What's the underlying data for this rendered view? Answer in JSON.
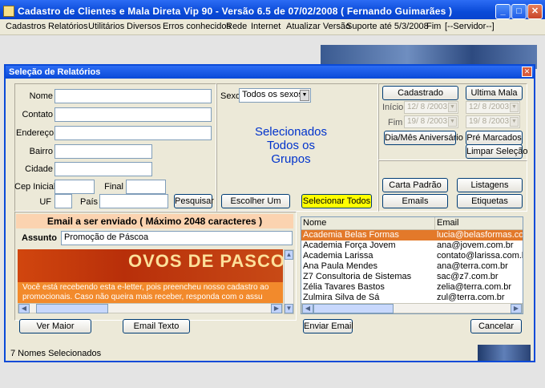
{
  "window": {
    "title": "Cadastro de Clientes e Mala Direta Vip 90  -  Versão 6.5 de 07/02/2008  ( Fernando Guimarães )",
    "buttons": {
      "minimize": "_",
      "maximize": "□",
      "close": "✕"
    }
  },
  "menu": [
    "Cadastros",
    "Relatórios",
    "Utilitários",
    "Diversos",
    "Erros conhecidos",
    "Rede",
    "Internet",
    "Atualizar Versão",
    "Suporte até 5/3/2008",
    "Fim",
    "[--Servidor--]"
  ],
  "dialog": {
    "title": "Seleção de Relatórios",
    "close_label": "✕",
    "fields": {
      "nome": "Nome",
      "contato": "Contato",
      "endereco": "Endereço",
      "bairro": "Bairro",
      "cidade": "Cidade",
      "cep_inicial": "Cep Inicial",
      "final": "Final",
      "uf": "UF",
      "pais": "País"
    },
    "pesquisar": "Pesquisar",
    "sexo_label": "Sexo",
    "sexo_value": "Todos os sexos",
    "selecionados": [
      "Selecionados",
      "Todos os",
      "Grupos"
    ],
    "escolher_um": "Escolher Um",
    "selecionar_todos": "Selecionar Todos",
    "cadastrado": "Cadastrado",
    "ultima_mala": "Ultima Mala",
    "inicio_label": "Início",
    "fim_label": "Fim",
    "dates": {
      "inicio_1": "12/ 8 /2003",
      "inicio_2": "12/ 8 /2003",
      "fim_1": "19/ 8 /2003",
      "fim_2": "19/ 8 /2003"
    },
    "dia_mes_aniversario": "Dia/Mês Aniversário",
    "pre_marcados": "Pré Marcados",
    "limpar_selecao": "Limpar Seleção",
    "carta_padrao": "Carta Padrão",
    "listagens": "Listagens",
    "emails": "Emails",
    "etiquetas": "Etiquetas",
    "email_header": "Email a ser enviado ( Máximo 2048 caracteres )",
    "assunto_label": "Assunto",
    "assunto_value": "Promoção de Páscoa",
    "banner_text": "OVOS DE PASCOA",
    "message_lines": [
      "Você está recebendo esta e-letter, pois preencheu nosso cadastro ao",
      "promocionais. Caso não queira mais receber, responda com o assu"
    ],
    "ver_maior": "Ver Maior",
    "email_texto": "Email Texto",
    "enviar_email": "Enviar Email",
    "cancelar": "Cancelar",
    "grid": {
      "columns": [
        "Nome",
        "Email"
      ],
      "rows": [
        [
          "Academia Belas Formas",
          "lucia@belasformas.com.br"
        ],
        [
          "Academia Força Jovem",
          "ana@jovem.com.br"
        ],
        [
          "Academia Larissa",
          "contato@larissa.com.br"
        ],
        [
          "Ana Paula Mendes",
          "ana@terra.com.br"
        ],
        [
          "Z7 Consultoria de Sistemas",
          "sac@z7.com.br"
        ],
        [
          "Zélia Tavares Bastos",
          "zelia@terra.com.br"
        ],
        [
          "Zulmira Silva de Sá",
          "zul@terra.com.br"
        ]
      ]
    },
    "status": "7 Nomes Selecionados"
  }
}
